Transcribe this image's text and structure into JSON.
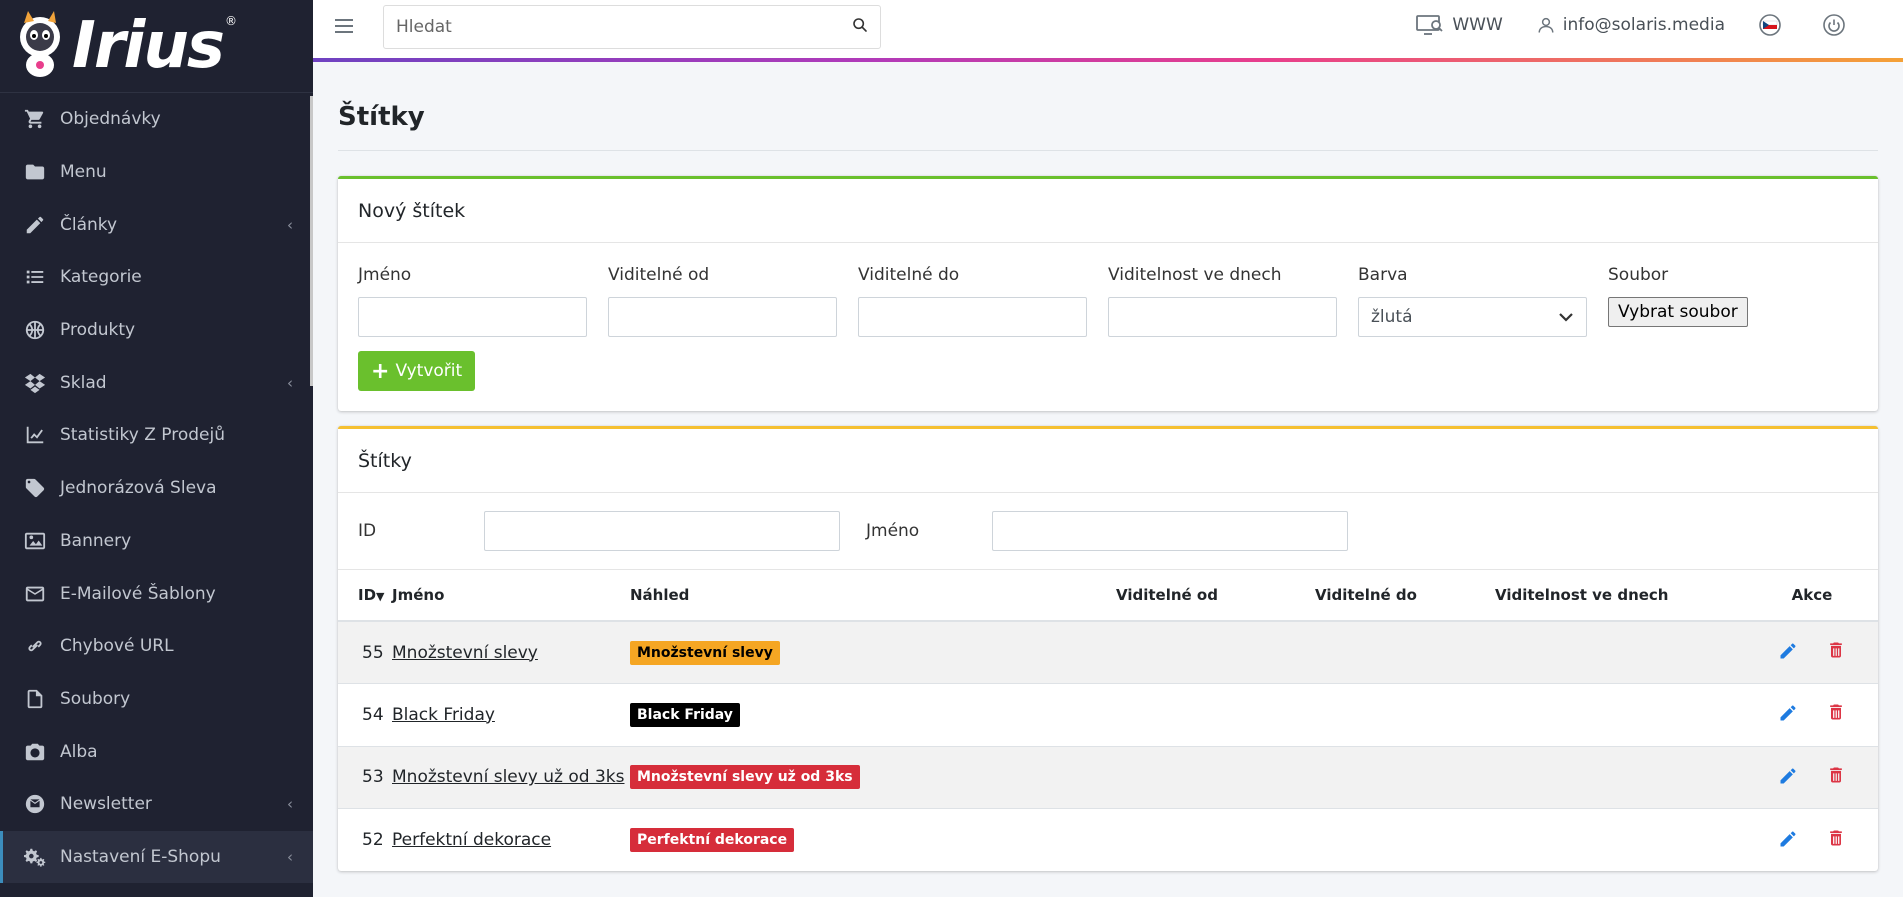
{
  "brand": {
    "logo_text": "Irius",
    "reg": "®"
  },
  "sidebar": {
    "items": [
      {
        "label": "Objednávky",
        "icon": "cart-icon",
        "chevron": ""
      },
      {
        "label": "Menu",
        "icon": "folder-icon",
        "chevron": ""
      },
      {
        "label": "Články",
        "icon": "pencil-icon",
        "chevron": "‹"
      },
      {
        "label": "Kategorie",
        "icon": "list-icon",
        "chevron": ""
      },
      {
        "label": "Produkty",
        "icon": "basketball-icon",
        "chevron": ""
      },
      {
        "label": "Sklad",
        "icon": "dropbox-icon",
        "chevron": "‹"
      },
      {
        "label": "Statistiky Z Prodejů",
        "icon": "chart-line-icon",
        "chevron": ""
      },
      {
        "label": "Jednorázová Sleva",
        "icon": "tag-icon",
        "chevron": ""
      },
      {
        "label": "Bannery",
        "icon": "image-icon",
        "chevron": ""
      },
      {
        "label": "E-Mailové Šablony",
        "icon": "envelope-icon",
        "chevron": ""
      },
      {
        "label": "Chybové URL",
        "icon": "link-icon",
        "chevron": ""
      },
      {
        "label": "Soubory",
        "icon": "file-icon",
        "chevron": ""
      },
      {
        "label": "Alba",
        "icon": "camera-icon",
        "chevron": ""
      },
      {
        "label": "Newsletter",
        "icon": "newsletter-icon",
        "chevron": "‹"
      },
      {
        "label": "Nastavení E-Shopu",
        "icon": "cogs-icon",
        "chevron": "‹"
      }
    ]
  },
  "topbar": {
    "search_placeholder": "Hledat",
    "www_label": "WWW",
    "user_email": "info@solaris.media"
  },
  "page": {
    "title": "Štítky"
  },
  "new_tag": {
    "header": "Nový štítek",
    "fields": {
      "name_label": "Jméno",
      "from_label": "Viditelné od",
      "to_label": "Viditelné do",
      "days_label": "Viditelnost ve dnech",
      "color_label": "Barva",
      "color_value": "žlutá",
      "file_label": "Soubor",
      "file_button": "Vybrat soubor"
    },
    "create_button": "Vytvořit"
  },
  "tags": {
    "header": "Štítky",
    "filter": {
      "id_label": "ID",
      "name_label": "Jméno"
    },
    "columns": {
      "id": "ID",
      "name": "Jméno",
      "preview": "Náhled",
      "from": "Viditelné od",
      "to": "Viditelné do",
      "days": "Viditelnost ve dnech",
      "actions": "Akce"
    },
    "rows": [
      {
        "id": "55",
        "name": "Množstevní slevy",
        "badge": "Množstevní slevy",
        "badge_bg": "#f5a623",
        "badge_fg": "#000000"
      },
      {
        "id": "54",
        "name": "Black Friday",
        "badge": "Black Friday",
        "badge_bg": "#000000",
        "badge_fg": "#ffffff"
      },
      {
        "id": "53",
        "name": "Množstevní slevy už od 3ks",
        "badge": "Množstevní slevy už od 3ks",
        "badge_bg": "#d62d3a",
        "badge_fg": "#ffffff"
      },
      {
        "id": "52",
        "name": "Perfektní dekorace",
        "badge": "Perfektní dekorace",
        "badge_bg": "#d62d3a",
        "badge_fg": "#ffffff"
      }
    ]
  },
  "colors": {
    "sidebar_bg": "#1f2231",
    "accent_green": "#6ac02d",
    "accent_yellow": "#f5c031",
    "edit_blue": "#1e7be0",
    "delete_red": "#dc3545"
  }
}
